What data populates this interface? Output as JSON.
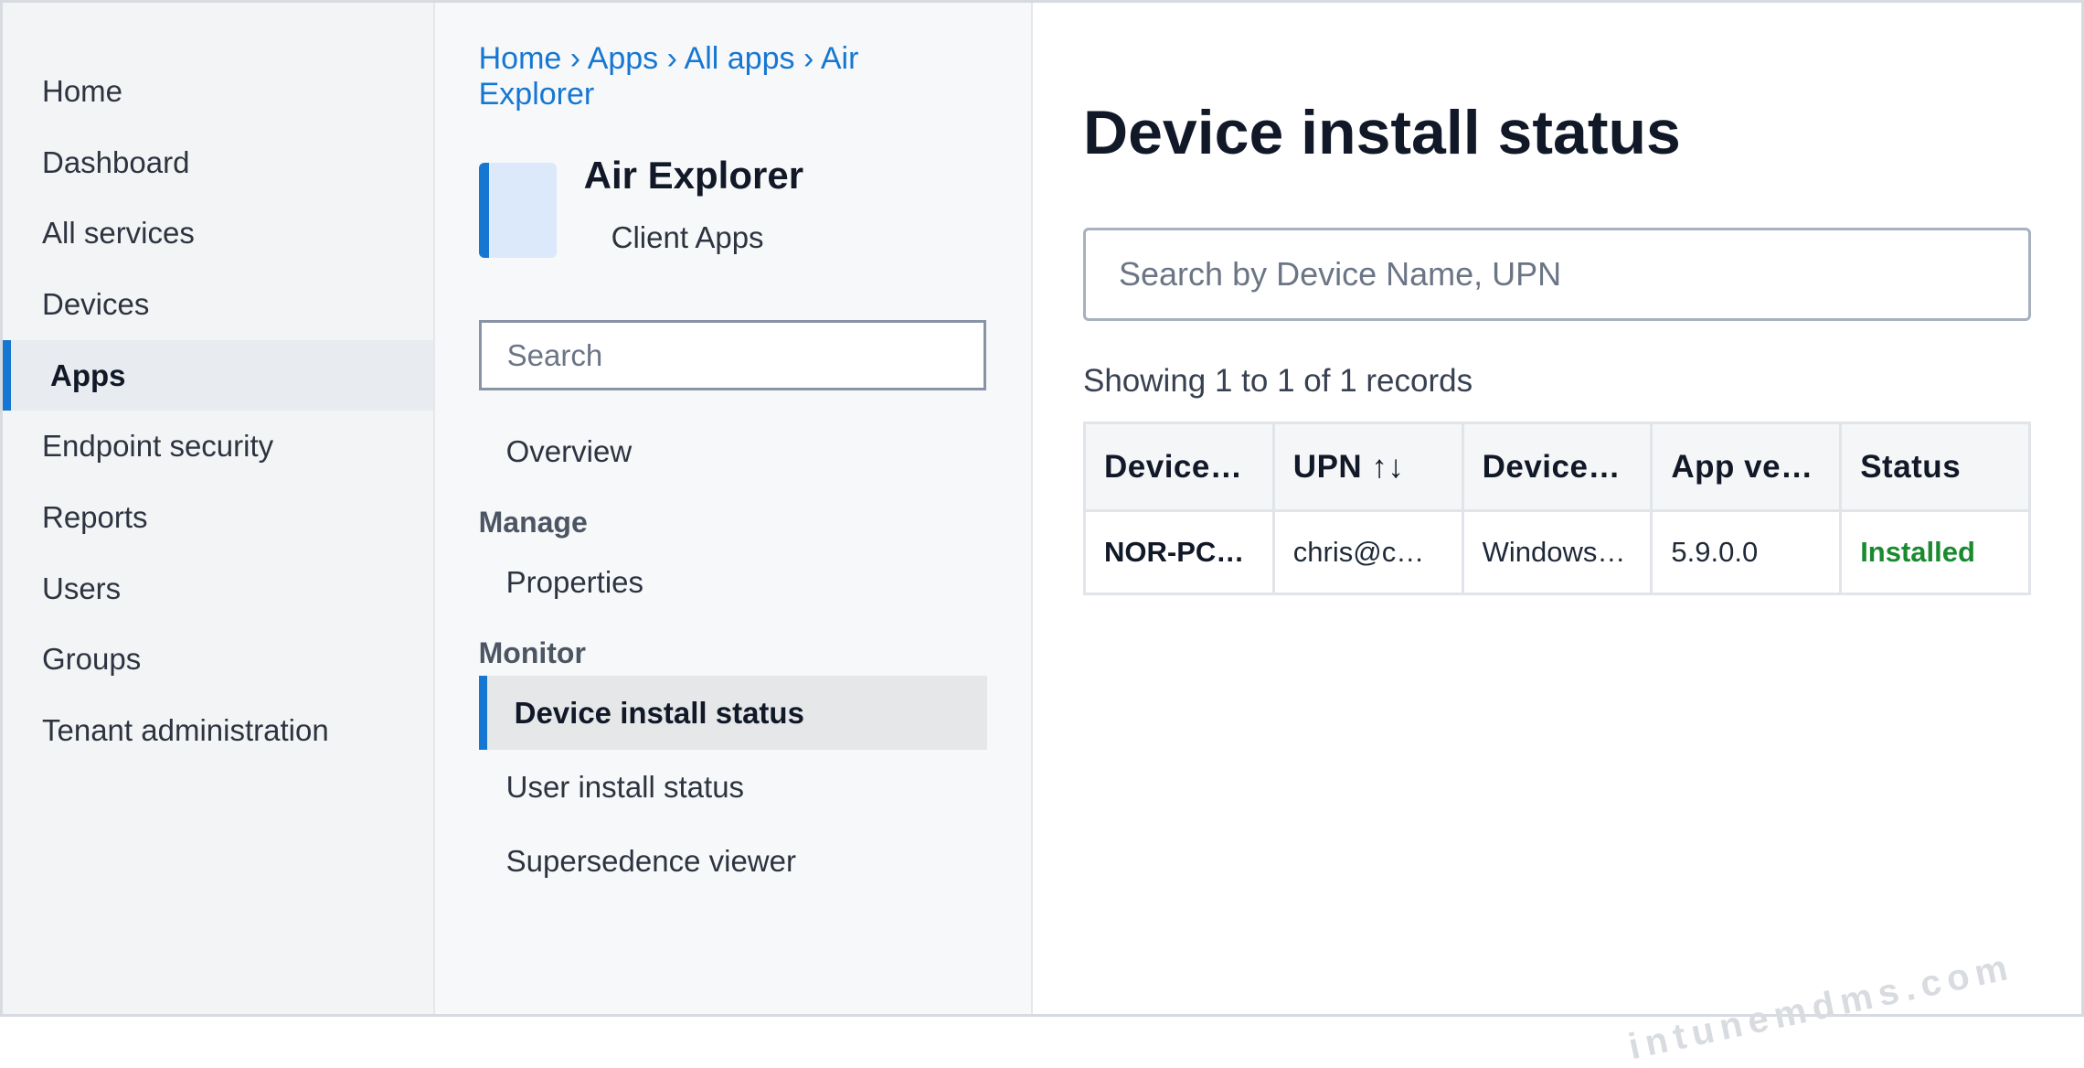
{
  "left_nav": {
    "items": [
      {
        "label": "Home"
      },
      {
        "label": "Dashboard"
      },
      {
        "label": "All services"
      },
      {
        "label": "Devices"
      },
      {
        "label": "Apps"
      },
      {
        "label": "Endpoint security"
      },
      {
        "label": "Reports"
      },
      {
        "label": "Users"
      },
      {
        "label": "Groups"
      },
      {
        "label": "Tenant administration"
      }
    ],
    "active": "Apps"
  },
  "breadcrumb": {
    "items": [
      "Home",
      "Apps",
      "All apps",
      "Air Explorer"
    ],
    "separator": "›"
  },
  "app": {
    "title": "Air Explorer",
    "subtitle": "Client Apps"
  },
  "blade": {
    "search_placeholder": "Search",
    "overview": "Overview",
    "manage_header": "Manage",
    "properties": "Properties",
    "monitor_header": "Monitor",
    "device_install_status": "Device install status",
    "user_install_status": "User install status",
    "supersedence_viewer": "Supersedence viewer"
  },
  "main": {
    "title": "Device install status",
    "search_placeholder": "Search by Device Name, UPN",
    "records_text": "Showing 1 to 1 of 1 records",
    "table": {
      "headers": [
        "Device…",
        "UPN ↑↓",
        "Device…",
        "App ve…",
        "Status"
      ],
      "rows": [
        [
          "NOR-PC…",
          "chris@c…",
          "Windows…",
          "5.9.0.0",
          "Installed"
        ]
      ]
    }
  },
  "watermark": "intunemdms.com",
  "colors": {
    "accent": "#1677d2",
    "status_installed": "#1a8a2e"
  }
}
